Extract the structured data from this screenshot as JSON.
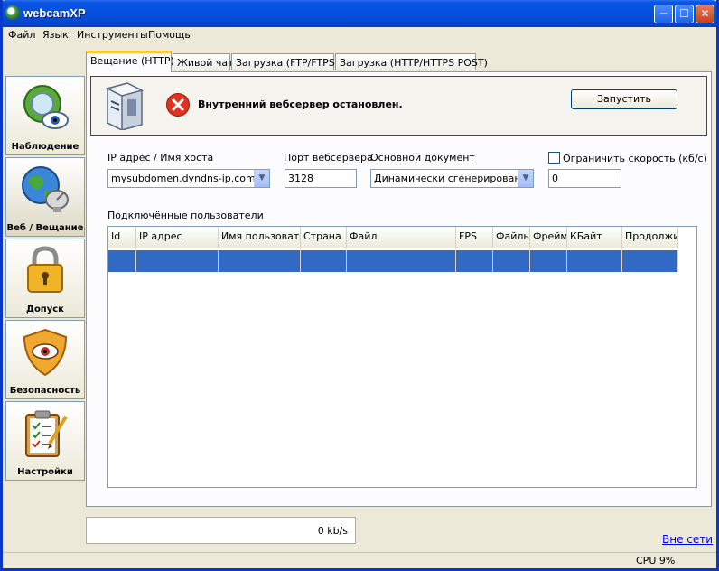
{
  "window": {
    "title": "webcamXP"
  },
  "menu": [
    "Файл",
    "Язык",
    "Инструменты",
    "Помощь"
  ],
  "nav": [
    {
      "label": "Наблюдение",
      "icon": "eye-lens-icon"
    },
    {
      "label": "Веб / Вещание",
      "icon": "globe-dish-icon"
    },
    {
      "label": "Допуск",
      "icon": "padlock-icon"
    },
    {
      "label": "Безопасность",
      "icon": "eye-shield-icon"
    },
    {
      "label": "Настройки",
      "icon": "clipboard-checklist-icon"
    }
  ],
  "tabs": [
    "Вещание (HTTP)",
    "Живой чат",
    "Загрузка (FTP/FTPS)",
    "Загрузка (HTTP/HTTPS POST)"
  ],
  "banner": {
    "message": "Внутренний вебсервер остановлен.",
    "start_button": "Запустить"
  },
  "form": {
    "ip_label": "IP адрес / Имя хоста",
    "ip_value": "mysubdomen.dyndns-ip.com",
    "port_label": "Порт вебсервера",
    "port_value": "3128",
    "doc_label": "Основной документ",
    "doc_value": "Динамически сгенерированный",
    "limit_label": "Ограничить скорость (кб/с)",
    "limit_value": "0"
  },
  "users": {
    "label": "Подключённые пользователи",
    "columns": [
      "Id",
      "IP адрес",
      "Имя пользователя",
      "Страна",
      "Файл",
      "FPS",
      "Файлы",
      "Фреймы",
      "КБайт",
      "Продолжит"
    ]
  },
  "footer": {
    "speed": "0 kb/s",
    "offline": "Вне сети",
    "cpu": "CPU 9%"
  }
}
